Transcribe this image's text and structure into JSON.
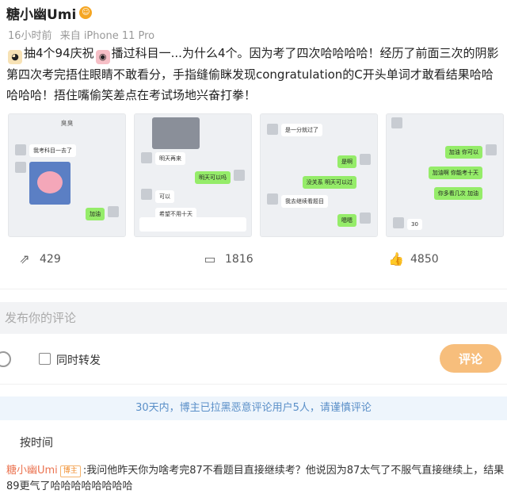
{
  "post": {
    "author": "糖小幽Umi",
    "author_badge": "vip-emoji-icon",
    "time": "16小时前",
    "source": "来自 iPhone 11 Pro",
    "text_part1": "抽4个94庆祝",
    "text_part2": "播过科目一...为什么4个。因为考了四次哈哈哈哈！经历了前面三次的阴影第四次考完捂住眼睛不敢看分，手指缝偷眯发现congratulation的C开头单词才敢看结果哈哈哈哈哈！捂住嘴偷笑差点在考试场地兴奋打拳！",
    "emoji1": "dog-emoji-icon",
    "emoji2": "pig-emoji-icon"
  },
  "thumbnails": [
    {
      "title": "臭臭",
      "messages": [
        {
          "side": "left",
          "text": "我考科目一去了"
        },
        {
          "side": "right",
          "text": "加油"
        }
      ]
    },
    {
      "messages": [
        {
          "side": "left",
          "text": "明天再来"
        },
        {
          "side": "right",
          "text": "明天可以吗"
        },
        {
          "side": "left",
          "text": "可以"
        },
        {
          "side": "left",
          "text": "希望不用十天"
        }
      ]
    },
    {
      "messages": [
        {
          "side": "left",
          "text": "是一分就过了"
        },
        {
          "side": "right",
          "text": "是啊"
        },
        {
          "side": "right",
          "text": "没关系 明天可以过"
        },
        {
          "side": "left",
          "text": "我去继续看题目"
        },
        {
          "side": "right",
          "text": "嗯嗯"
        }
      ]
    },
    {
      "messages": [
        {
          "side": "right",
          "text": "加油 你可以"
        },
        {
          "side": "right",
          "text": "加油啊 你能考十天"
        },
        {
          "side": "right",
          "text": "你多看几次 加油"
        },
        {
          "side": "left",
          "text": "30"
        }
      ]
    }
  ],
  "actions": {
    "share_count": "429",
    "comment_count": "1816",
    "like_count": "4850"
  },
  "comment_box": {
    "placeholder": "发布你的评论",
    "repost_label": "同时转发",
    "submit_label": "评论"
  },
  "notice": "30天内，博主已拉黑恶意评论用户5人，请谨慎评论",
  "sort_label": "按时间",
  "reply": {
    "user": "糖小幽Umi",
    "tag": "博主",
    "text": ":我问他昨天你为啥考完87不看题目直接继续考？他说因为87太气了不服气直接继续上，结果89更气了哈哈哈哈哈哈哈哈"
  }
}
